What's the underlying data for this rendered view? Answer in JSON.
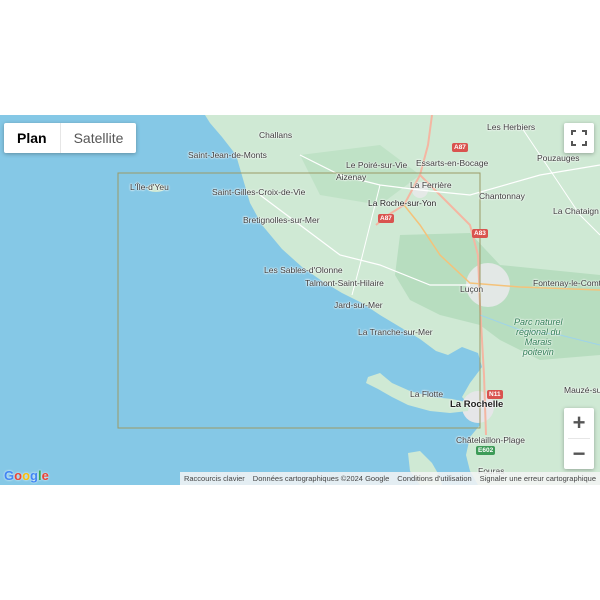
{
  "map_type": {
    "plan_label": "Plan",
    "satellite_label": "Satellite",
    "selected": "Plan"
  },
  "controls": {
    "fullscreen_icon": "fullscreen-icon",
    "zoom_in_label": "+",
    "zoom_out_label": "−"
  },
  "logo": {
    "text": "Google",
    "colors": [
      "#4285f4",
      "#ea4335",
      "#fbbc05",
      "#4285f4",
      "#34a853",
      "#ea4335"
    ]
  },
  "attribution": {
    "shortcuts": "Raccourcis clavier",
    "data": "Données cartographiques ©2024 Google",
    "terms": "Conditions d'utilisation",
    "report": "Signaler une erreur cartographique"
  },
  "places": {
    "challans": "Challans",
    "les_herbiers": "Les Herbiers",
    "saint_jean_de_monts": "Saint-Jean-de-Monts",
    "le_poire_sur_vie": "Le Poiré-sur-Vie",
    "essarts_en_bocage": "Essarts-en-Bocage",
    "pouzauges": "Pouzauges",
    "aizenay": "Aizenay",
    "lile_dyeu": "L'Île-d'Yeu",
    "la_ferriere": "La Ferrière",
    "saint_gilles": "Saint-Gilles-Croix-de-Vie",
    "chantonnay": "Chantonnay",
    "la_roche_sur_yon": "La Roche-sur-Yon",
    "la_chataigneraie": "La Chataign",
    "bretignolles": "Bretignolles-sur-Mer",
    "les_sables": "Les Sables-d'Olonne",
    "talmont": "Talmont-Saint-Hilaire",
    "fontenay": "Fontenay-le-Comt",
    "lucon": "Luçon",
    "jard": "Jard-sur-Mer",
    "parc": "Parc naturel\nrégional du\nMarais\npoitevin",
    "la_tranche": "La Tranche-sur-Mer",
    "mauze": "Mauzé-su",
    "la_flotte": "La Flotte",
    "la_rochelle": "La Rochelle",
    "chatelaillon": "Châtelaillon-Plage",
    "fouras": "Fouras"
  },
  "roads": {
    "a87_top": "A87",
    "a87": "A87",
    "a83": "A83",
    "n11": "N11",
    "e602": "E602"
  }
}
